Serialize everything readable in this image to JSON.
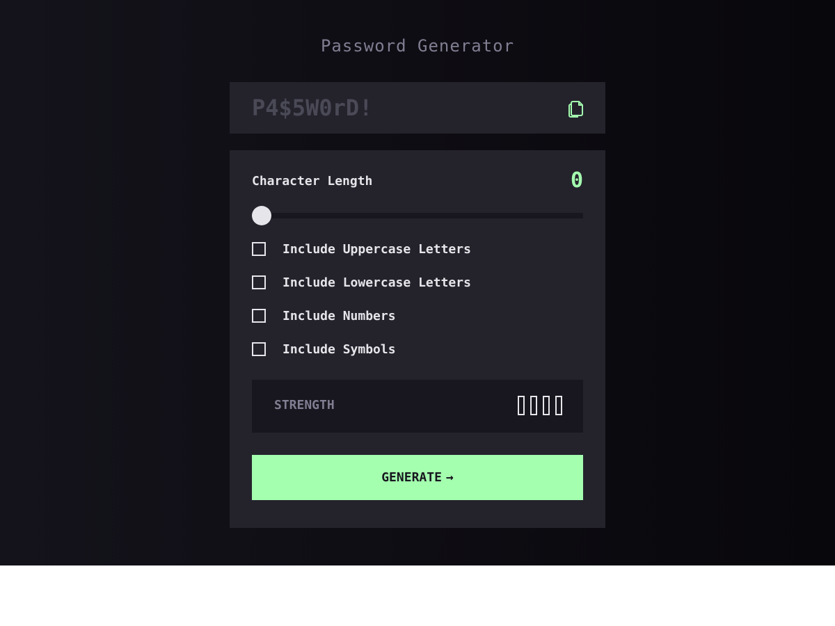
{
  "app": {
    "title": "Password Generator"
  },
  "output": {
    "password_placeholder": "P4$5W0rD!",
    "copy_icon": "copy-icon"
  },
  "length": {
    "label": "Character Length",
    "value": "0",
    "slider_fraction": 0
  },
  "options": [
    {
      "label": "Include Uppercase Letters",
      "checked": false
    },
    {
      "label": "Include Lowercase Letters",
      "checked": false
    },
    {
      "label": "Include Numbers",
      "checked": false
    },
    {
      "label": "Include Symbols",
      "checked": false
    }
  ],
  "strength": {
    "label": "STRENGTH",
    "filled_bars": 0,
    "total_bars": 4
  },
  "generate": {
    "label": "GENERATE",
    "arrow": "→"
  },
  "colors": {
    "accent": "#a4ffaf",
    "panel": "#24232c",
    "text": "#e6e5ea",
    "muted": "#817d92"
  }
}
